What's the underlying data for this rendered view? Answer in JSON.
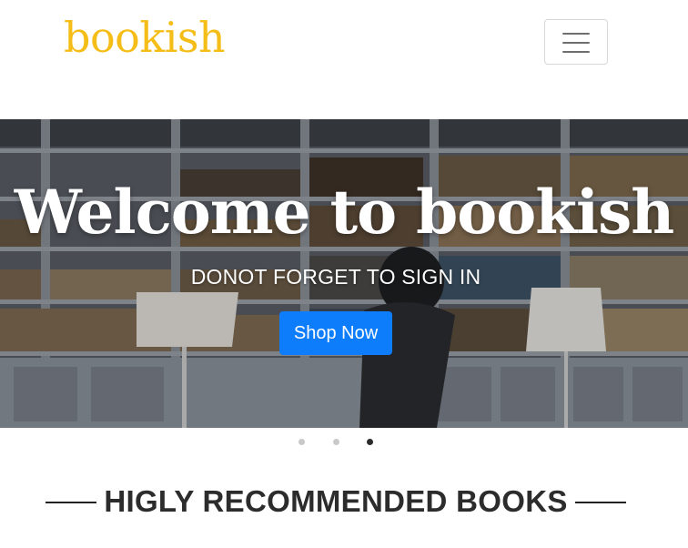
{
  "navbar": {
    "brand": "bookish",
    "brand_color": "#f5bd17",
    "toggler_icon": "hamburger-menu-icon"
  },
  "hero": {
    "title": "Welcome to bookish",
    "subtitle": "DONOT FORGET TO SIGN IN",
    "button_label": "Shop Now",
    "button_color": "#0d7dfb",
    "slide_count": 3,
    "active_slide": 3
  },
  "section": {
    "title": "HIGLY RECOMMENDED BOOKS"
  }
}
